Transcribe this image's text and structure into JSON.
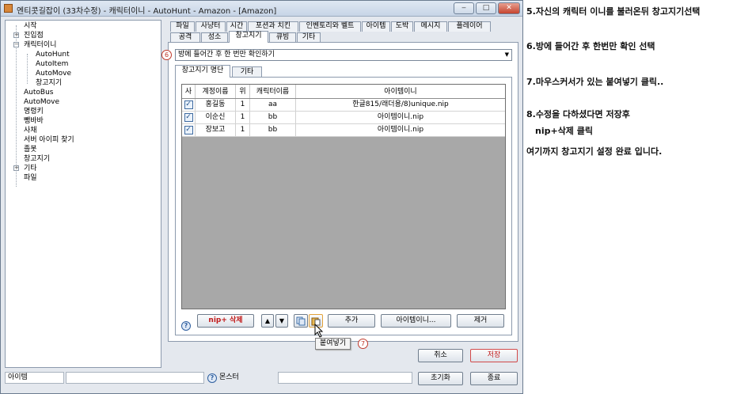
{
  "window": {
    "title": "엔티콧길잡이 (33차수정) - 캐릭터이니 - AutoHunt - Amazon - [Amazon]",
    "min_label": "‒",
    "max_label": "□",
    "close_label": "✕"
  },
  "tree": [
    {
      "label": "시작",
      "level": 0,
      "toggle": ""
    },
    {
      "label": "진입점",
      "level": 0,
      "toggle": "+"
    },
    {
      "label": "캐릭터이니",
      "level": 0,
      "toggle": "−"
    },
    {
      "label": "AutoHunt",
      "level": 1,
      "toggle": ""
    },
    {
      "label": "AutoItem",
      "level": 1,
      "toggle": ""
    },
    {
      "label": "AutoMove",
      "level": 1,
      "toggle": ""
    },
    {
      "label": "창고지기",
      "level": 1,
      "toggle": ""
    },
    {
      "label": "AutoBus",
      "level": 0,
      "toggle": ""
    },
    {
      "label": "AutoMove",
      "level": 0,
      "toggle": ""
    },
    {
      "label": "명령키",
      "level": 0,
      "toggle": ""
    },
    {
      "label": "뺑바바",
      "level": 0,
      "toggle": ""
    },
    {
      "label": "사채",
      "level": 0,
      "toggle": ""
    },
    {
      "label": "서버 아이피 찾기",
      "level": 0,
      "toggle": ""
    },
    {
      "label": "졸봇",
      "level": 0,
      "toggle": ""
    },
    {
      "label": "창고지기",
      "level": 0,
      "toggle": ""
    },
    {
      "label": "기타",
      "level": 0,
      "toggle": "+"
    },
    {
      "label": "파일",
      "level": 0,
      "toggle": ""
    }
  ],
  "tabs_row1": [
    "파일",
    "사냥터",
    "시간",
    "포션과 치킨",
    "인벤토리와 벨트",
    "아이템",
    "도박",
    "메시지",
    "플레이어"
  ],
  "tabs_row2": [
    "공격",
    "성소",
    "창고지기",
    "큐빙",
    "기타"
  ],
  "active_tab": "창고지기",
  "combo": {
    "value": "방에 들어간 후 한 번만 확인하기",
    "arrow": "▼"
  },
  "markers": {
    "m6": "6",
    "m7": "7"
  },
  "inner_tabs": [
    "창고지기 명단",
    "기타"
  ],
  "grid": {
    "headers": [
      "사",
      "계정이름",
      "위",
      "캐릭터이름",
      "아이템이니"
    ],
    "rows": [
      {
        "checked": "✓",
        "account": "홍길동",
        "pos": "1",
        "char": "aa",
        "item": "한글815/래더용/8)unique.nip"
      },
      {
        "checked": "✓",
        "account": "이순신",
        "pos": "1",
        "char": "bb",
        "item": "아이템이니.nip"
      },
      {
        "checked": "✓",
        "account": "장보고",
        "pos": "1",
        "char": "bb",
        "item": "아이템이니.nip"
      }
    ]
  },
  "buttons": {
    "nip_delete": "nip+ 삭제",
    "up": "▲",
    "down": "▼",
    "add": "추가",
    "item_ini": "아이템이니...",
    "remove": "제거",
    "cancel": "취소",
    "save": "저장",
    "reset": "초기화",
    "exit": "종료",
    "help": "?"
  },
  "tooltip": "붙여넣기",
  "status": {
    "left": "아이템",
    "monster": "몬스터"
  },
  "colors": {
    "accent": "#c01818",
    "window_bg": "#e4e8ee"
  },
  "notes": [
    "5.자신의 캐릭터 이니를 불러온뒤 창고지기선택",
    "6.방에 들어간 후 한번만 확인 선택",
    "7.마우스커서가 있는 붙여넣기 클릭..",
    "8.수정을 다하셨다면 저장후",
    "nip+삭제 클릭",
    "여기까지 창고지기 설정 완료 입니다."
  ]
}
